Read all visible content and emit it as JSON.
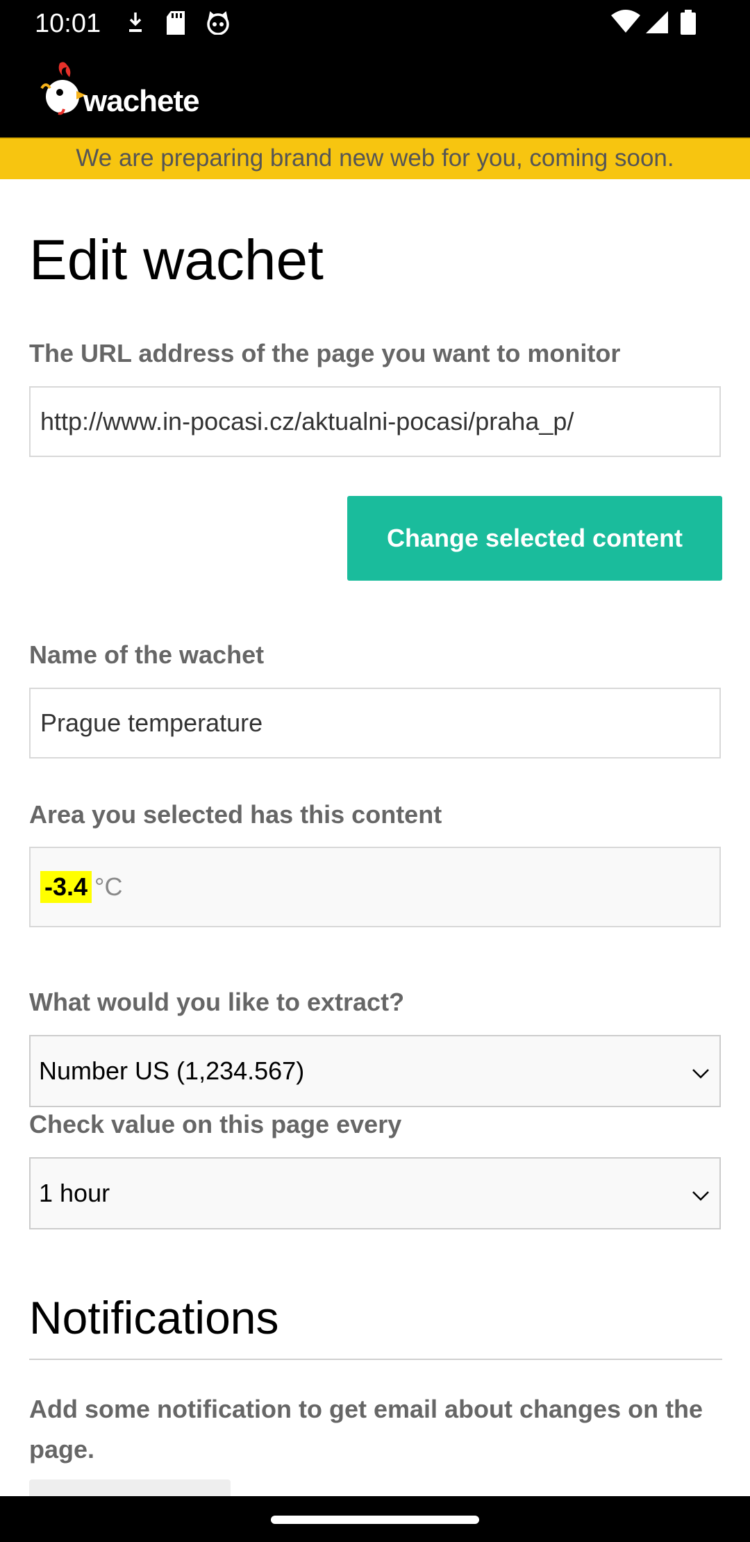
{
  "status_bar": {
    "time": "10:01",
    "left_icons": [
      "download-icon",
      "sd-card-icon",
      "cat-face-icon"
    ],
    "right_icons": [
      "wifi-icon",
      "signal-icon",
      "battery-icon"
    ]
  },
  "header": {
    "logo_text": "wachete",
    "logo_icon": "rooster-icon",
    "background": "#000000"
  },
  "banner": {
    "text": "We are preparing brand new web for you, coming soon.",
    "color": "#f7c510"
  },
  "form": {
    "title": "Edit wachet",
    "url_label": "The URL address of the page you want to monitor",
    "url_value": "http://www.in-pocasi.cz/aktualni-pocasi/praha_p/",
    "change_button": "Change selected content",
    "name_label": "Name of the wachet",
    "name_value": "Prague temperature",
    "content_label": "Area you selected has this content",
    "content_value": "-3.4",
    "content_unit": "°C",
    "extract_label": "What would you like to extract?",
    "extract_selected": "Number US (1,234.567)",
    "interval_label": "Check value on this page every",
    "interval_selected": "1 hour"
  },
  "notifications": {
    "title": "Notifications",
    "description": "Add some notification to get email about changes on the page."
  },
  "colors": {
    "accent": "#1abc9c",
    "highlight": "#ffff00"
  }
}
